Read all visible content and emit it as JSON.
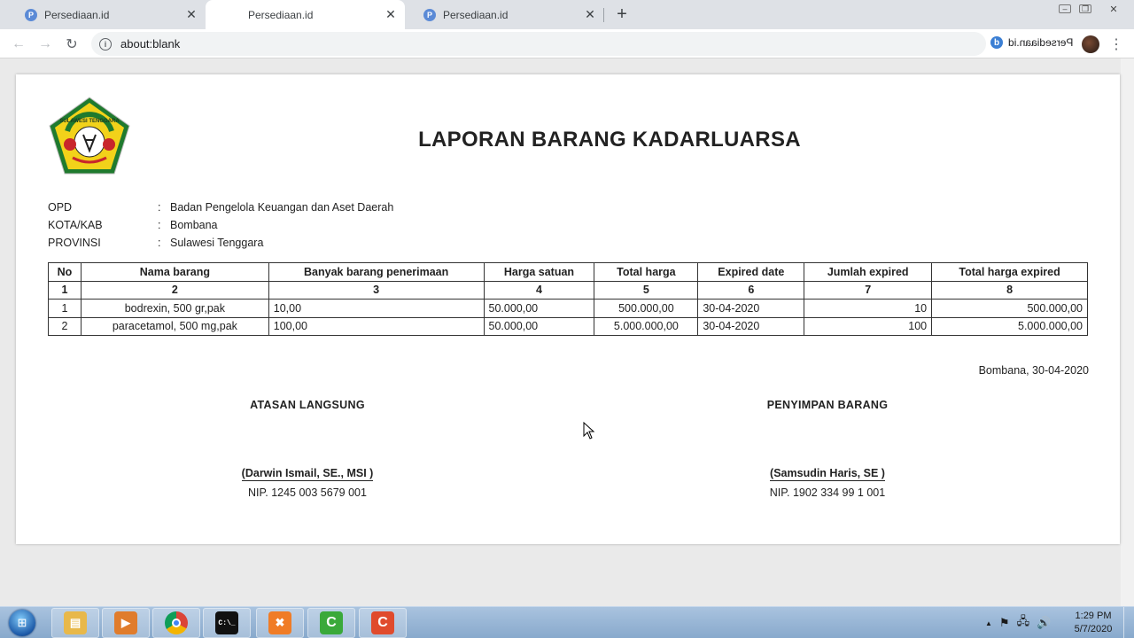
{
  "browser": {
    "tabs": [
      {
        "label": "Persediaan.id",
        "favicon": "P"
      },
      {
        "label": "Persediaan.id",
        "favicon": ""
      },
      {
        "label": "Persediaan.id",
        "favicon": "P"
      }
    ],
    "address": "about:blank",
    "extension_label": "Persediaan.id",
    "extension_icon": "b",
    "info_icon": "i"
  },
  "report": {
    "title": "LAPORAN BARANG KADARLUARSA",
    "meta": [
      {
        "key": "OPD",
        "sep": ":",
        "value": "Badan Pengelola Keuangan dan Aset Daerah"
      },
      {
        "key": "KOTA/KAB",
        "sep": ":",
        "value": "Bombana"
      },
      {
        "key": "PROVINSI",
        "sep": ":",
        "value": "Sulawesi Tenggara"
      }
    ],
    "columns": [
      "No",
      "Nama barang",
      "Banyak barang penerimaan",
      "Harga satuan",
      "Total harga",
      "Expired date",
      "Jumlah expired",
      "Total harga expired"
    ],
    "column_numbers": [
      "1",
      "2",
      "3",
      "4",
      "5",
      "6",
      "7",
      "8"
    ],
    "rows": [
      [
        "1",
        "bodrexin, 500 gr,pak",
        "10,00",
        "50.000,00",
        "500.000,00",
        "30-04-2020",
        "10",
        "500.000,00"
      ],
      [
        "2",
        "paracetamol, 500 mg,pak",
        "100,00",
        "50.000,00",
        "5.000.000,00",
        "30-04-2020",
        "100",
        "5.000.000,00"
      ]
    ],
    "place_date": "Bombana, 30-04-2020",
    "signatures": {
      "left": {
        "role": "ATASAN LANGSUNG",
        "name": "(Darwin Ismail, SE., MSI )",
        "nip": "NIP. 1245 003 5679 001"
      },
      "right": {
        "role": "PENYIMPAN BARANG",
        "name": "(Samsudin Haris, SE )",
        "nip": "NIP. 1902 334 99 1 001"
      }
    },
    "logo_text": "SULAWESI TENGGARA"
  },
  "taskbar": {
    "start_icon": "⊞",
    "apps": [
      {
        "name": "explorer",
        "glyph": "▤",
        "color": "#e8b84a"
      },
      {
        "name": "media-player",
        "glyph": "▶",
        "color": "#e07c2c"
      },
      {
        "name": "chrome",
        "glyph": "◉",
        "color": "#d9473f"
      },
      {
        "name": "cmd",
        "glyph": "C:\\_",
        "color": "#111111"
      },
      {
        "name": "xampp",
        "glyph": "✖",
        "color": "#f07c26"
      },
      {
        "name": "camtasia-green",
        "glyph": "C",
        "color": "#3aa93a"
      },
      {
        "name": "camtasia-red",
        "glyph": "C",
        "color": "#e04b2d"
      }
    ],
    "clock_time": "1:29 PM",
    "clock_date": "5/7/2020",
    "tray_up_arrow": "▲"
  }
}
